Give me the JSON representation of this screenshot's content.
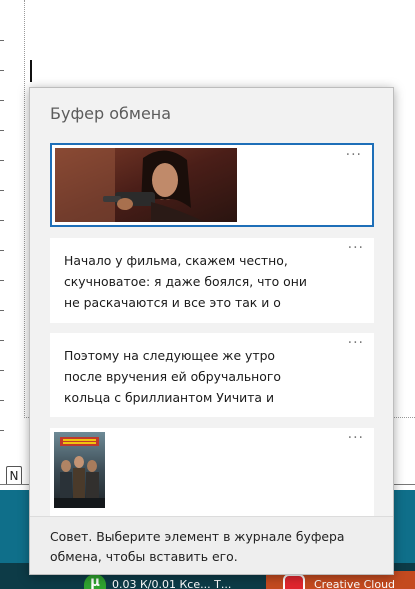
{
  "clipboard": {
    "title": "Буфер обмена",
    "items": [
      {
        "kind": "image",
        "image_desc": "woman-aiming-pistol-screenshot",
        "more_label": "···"
      },
      {
        "kind": "text",
        "text": "Начало у фильма, скажем честно, скучноватое: я даже боялся, что они не раскачаются и все это так и о",
        "more_label": "···"
      },
      {
        "kind": "text",
        "text": "Поэтому на следующее же утро после вручения ей обручального кольца с бриллиантом Уичита и",
        "more_label": "···"
      },
      {
        "kind": "image",
        "image_desc": "movie-poster-thumbnail",
        "more_label": "···"
      }
    ],
    "hint": "Совет. Выберите элемент в журнале буфера обмена, чтобы вставить его."
  },
  "taskbar": {
    "torrent_text": "0.03 К/0.01 Ксе... Т...",
    "torrent_icon_glyph": "µ",
    "creative_cloud_text": "Creative Cloud"
  },
  "document": {
    "sheet_tab_label": "N"
  },
  "colors": {
    "selection_border": "#1e6fb8",
    "flyout_bg": "#f2f2f2",
    "teal_band": "#0f6f8a",
    "taskbar": "#0d3b47",
    "creative_cloud": "#c44a1f"
  }
}
